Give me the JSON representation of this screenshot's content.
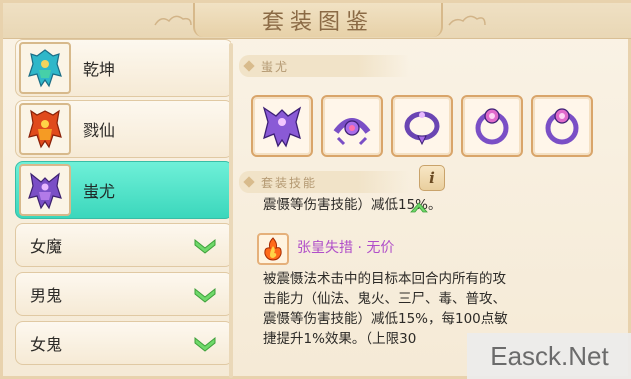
{
  "window": {
    "title": "套装图鉴"
  },
  "sidebar": {
    "suits": [
      {
        "label": "乾坤",
        "icon": "armor-qiankun-icon",
        "active": false
      },
      {
        "label": "戮仙",
        "icon": "armor-luxian-icon",
        "active": false
      },
      {
        "label": "蚩尤",
        "icon": "armor-chiyou-icon",
        "active": true
      }
    ],
    "categories": [
      {
        "label": "女魔",
        "icon": "chevron-down-icon"
      },
      {
        "label": "男鬼",
        "icon": "chevron-down-icon"
      },
      {
        "label": "女鬼",
        "icon": "chevron-down-icon"
      }
    ]
  },
  "main": {
    "equip_section_label": "蚩尤",
    "equipment": [
      {
        "icon": "robe-icon"
      },
      {
        "icon": "belt-icon"
      },
      {
        "icon": "necklace-icon"
      },
      {
        "icon": "ring-icon"
      },
      {
        "icon": "ring-icon"
      }
    ],
    "skill_section_label": "套装技能",
    "info_button": "i",
    "top_desc": "震慑等伤害技能）减低15%。",
    "skill": {
      "name": "张皇失措 · 无价",
      "desc_lines": [
        "被震慑法术击中的目标本回合内所有的攻",
        "击能力（仙法、鬼火、三尸、毒、普攻、",
        "震慑等伤害技能）减低15%，每100点敏",
        "捷提升1%效果。（上限30"
      ]
    }
  },
  "watermark": "Easck.Net",
  "colors": {
    "active_item": "#3bd7bc",
    "skill_name": "#b04fc9",
    "title_text": "#8b6a45",
    "equip_border": "#d9a56a"
  }
}
